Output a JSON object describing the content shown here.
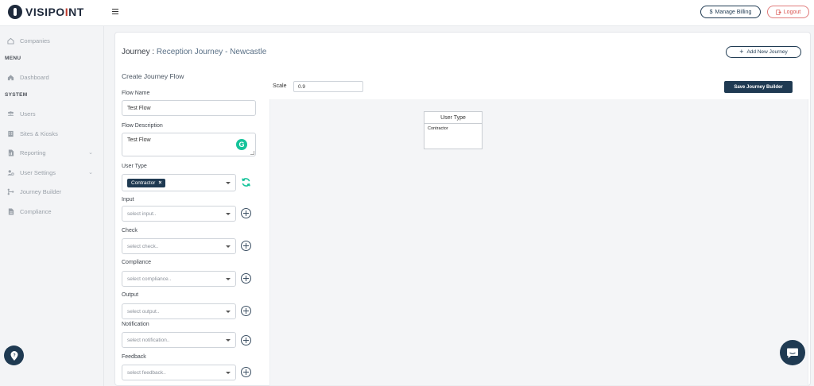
{
  "header": {
    "logo_prefix": "VISIPO",
    "logo_accent": "I",
    "logo_suffix": "NT",
    "billing_label": "Manage Billing",
    "logout_label": "Logout"
  },
  "sidebar": {
    "companies": "Companies",
    "menu_section": "MENU",
    "dashboard": "Dashboard",
    "system_section": "SYSTEM",
    "users": "Users",
    "sites": "Sites & Kiosks",
    "reporting": "Reporting",
    "user_settings": "User Settings",
    "journey_builder": "Journey Builder",
    "compliance": "Compliance"
  },
  "page": {
    "title_prefix": "Journey :",
    "journey_name": "Reception Journey - Newcastle",
    "add_journey_label": "Add New Journey",
    "form_heading": "Create Journey Flow"
  },
  "form": {
    "flow_name_label": "Flow Name",
    "flow_name_value": "Test Flow",
    "flow_desc_label": "Flow Description",
    "flow_desc_value": "Test Flow",
    "user_type_label": "User Type",
    "user_type_chip": "Contractor",
    "input_label": "Input",
    "input_placeholder": "select input..",
    "check_label": "Check",
    "check_placeholder": "select check..",
    "compliance_label": "Compliance",
    "compliance_placeholder": "select compliance..",
    "output_label": "Output",
    "output_placeholder": "select output..",
    "notification_label": "Notification",
    "notification_placeholder": "select notification..",
    "feedback_label": "Feedback",
    "feedback_placeholder": "select feedback.."
  },
  "builder": {
    "scale_label": "Scale",
    "scale_value": "0.9",
    "save_label": "Save Journey Builder",
    "node_title": "User Type",
    "node_item": "Contractor"
  },
  "colors": {
    "brand_navy": "#1f3a52",
    "accent_red": "#c0392b",
    "grammarly_green": "#15c39a"
  }
}
